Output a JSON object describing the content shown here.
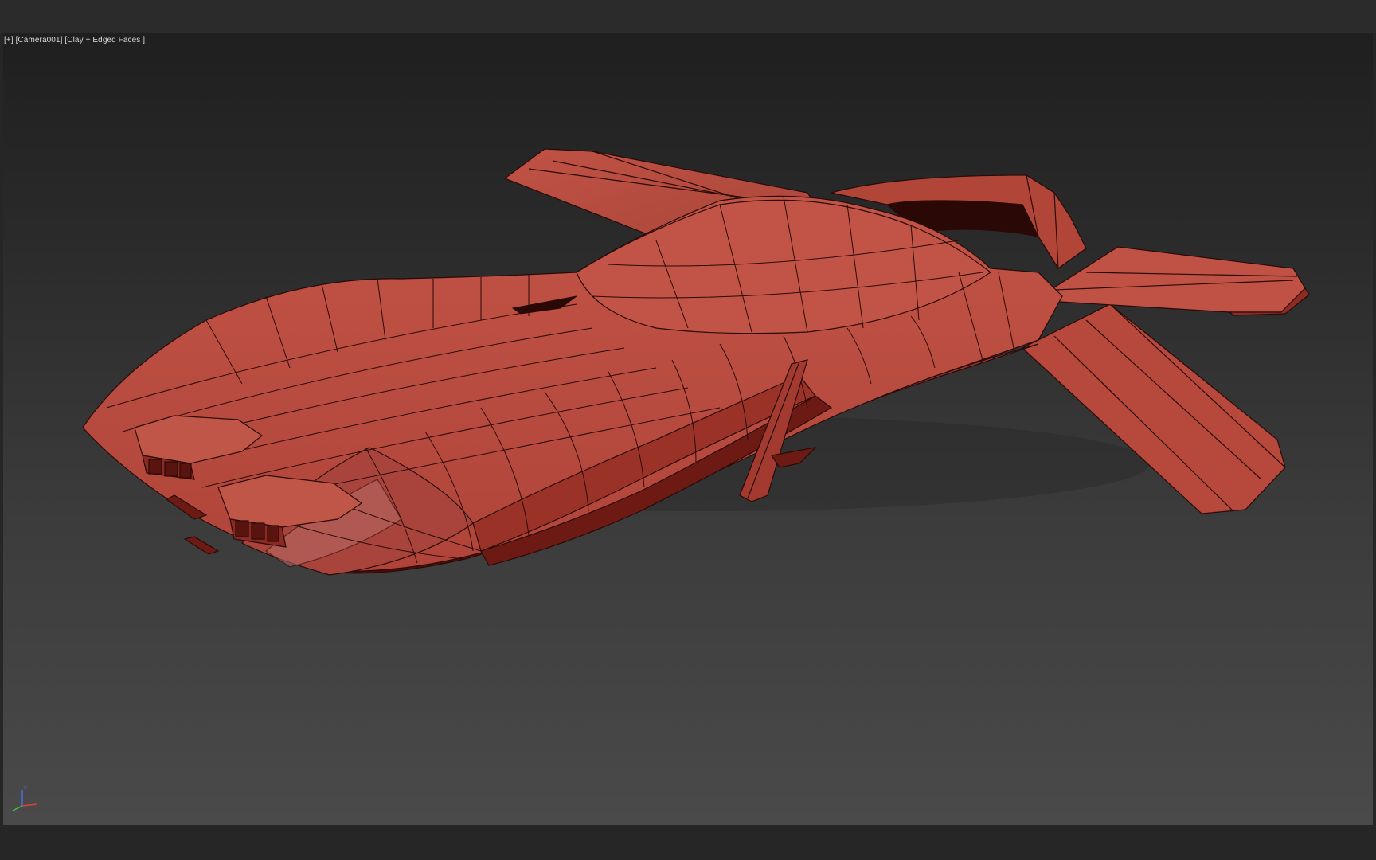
{
  "viewport": {
    "label_plus": "[+]",
    "label_camera": "[Camera001]",
    "label_shading": "[Clay + Edged Faces ]"
  },
  "gizmo": {
    "axis_z": "z"
  },
  "colors": {
    "clay": "#b84a3e",
    "clay_light": "#c45a4c",
    "clay_dark": "#8a2a22",
    "clay_shadow": "#5a1010",
    "edge": "#2a0a08",
    "bg_top": "#1f1f1f",
    "bg_bottom": "#4a4a4a"
  }
}
